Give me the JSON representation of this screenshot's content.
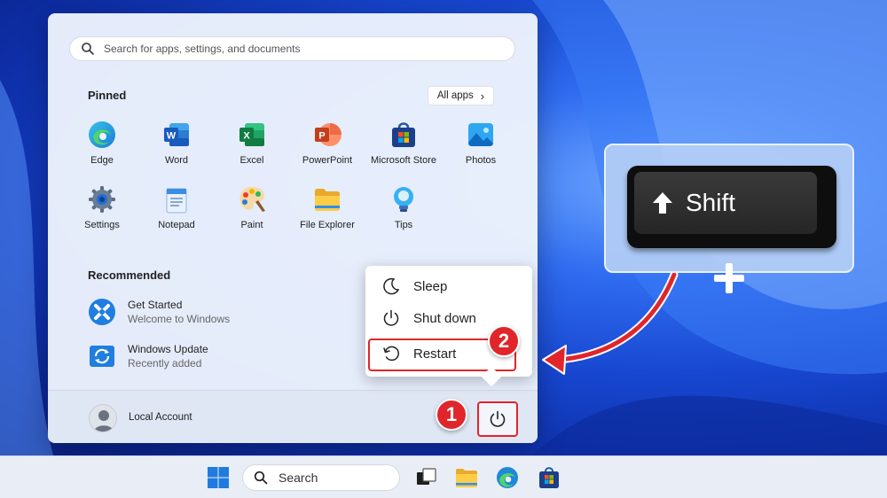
{
  "search": {
    "placeholder": "Search for apps, settings, and documents"
  },
  "pinned": {
    "title": "Pinned",
    "all_apps_label": "All apps",
    "apps": [
      {
        "label": "Edge",
        "icon": "edge-icon"
      },
      {
        "label": "Word",
        "icon": "word-icon"
      },
      {
        "label": "Excel",
        "icon": "excel-icon"
      },
      {
        "label": "PowerPoint",
        "icon": "powerpoint-icon"
      },
      {
        "label": "Microsoft Store",
        "icon": "store-icon"
      },
      {
        "label": "Photos",
        "icon": "photos-icon"
      },
      {
        "label": "Settings",
        "icon": "settings-gear-icon"
      },
      {
        "label": "Notepad",
        "icon": "notepad-icon"
      },
      {
        "label": "Paint",
        "icon": "paint-icon"
      },
      {
        "label": "File Explorer",
        "icon": "folder-icon"
      },
      {
        "label": "Tips",
        "icon": "lightbulb-icon"
      }
    ]
  },
  "recommended": {
    "title": "Recommended",
    "items": [
      {
        "title": "Get Started",
        "subtitle": "Welcome to Windows",
        "icon": "get-started-icon"
      },
      {
        "title": "Windows Update",
        "subtitle": "Recently added",
        "icon": "windows-update-icon"
      }
    ]
  },
  "account": {
    "name": "Local Account"
  },
  "power_menu": {
    "items": [
      {
        "label": "Sleep",
        "icon": "moon-icon"
      },
      {
        "label": "Shut down",
        "icon": "power-icon"
      },
      {
        "label": "Restart",
        "icon": "restart-icon"
      }
    ]
  },
  "steps": {
    "step1": "1",
    "step2": "2"
  },
  "shift_key": {
    "label": "Shift"
  },
  "taskbar": {
    "search_label": "Search"
  },
  "colors": {
    "accent": "#e0262a",
    "wallpaper": "#1a4fd6"
  }
}
